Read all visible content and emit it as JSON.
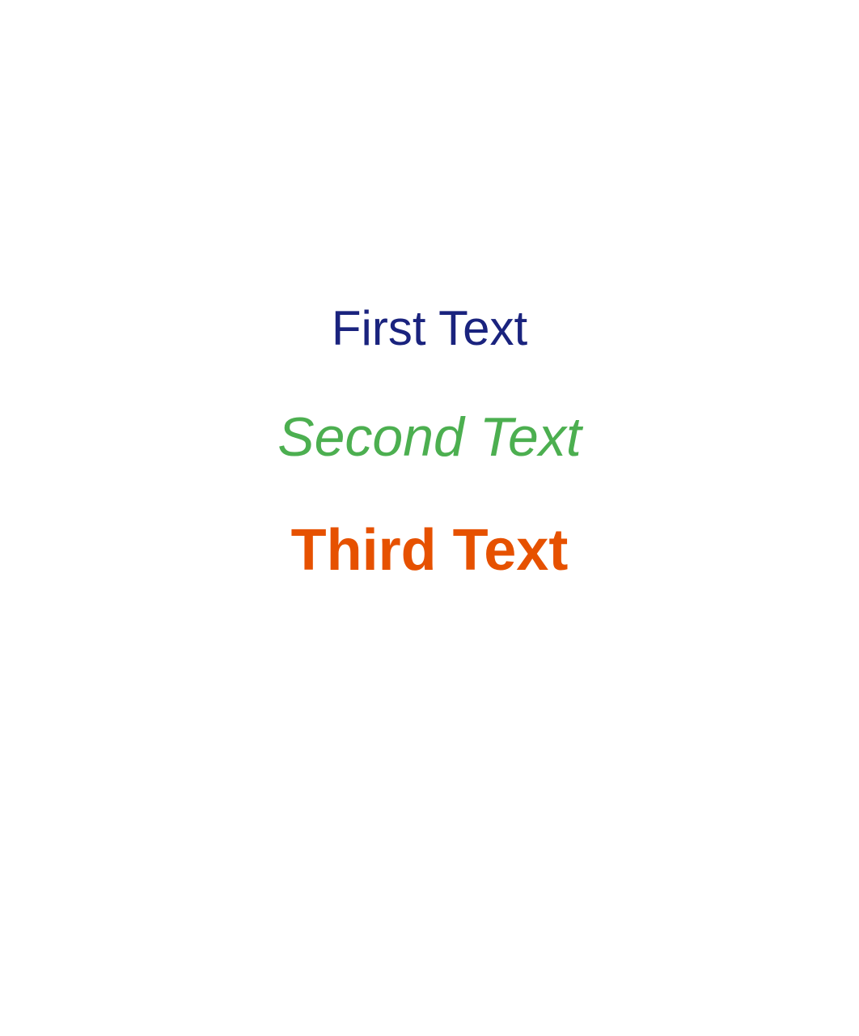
{
  "texts": {
    "first": {
      "label": "First Text",
      "color": "#1a237e"
    },
    "second": {
      "label": "Second Text",
      "color": "#4caf50"
    },
    "third": {
      "label": "Third Text",
      "color": "#e65100"
    }
  }
}
